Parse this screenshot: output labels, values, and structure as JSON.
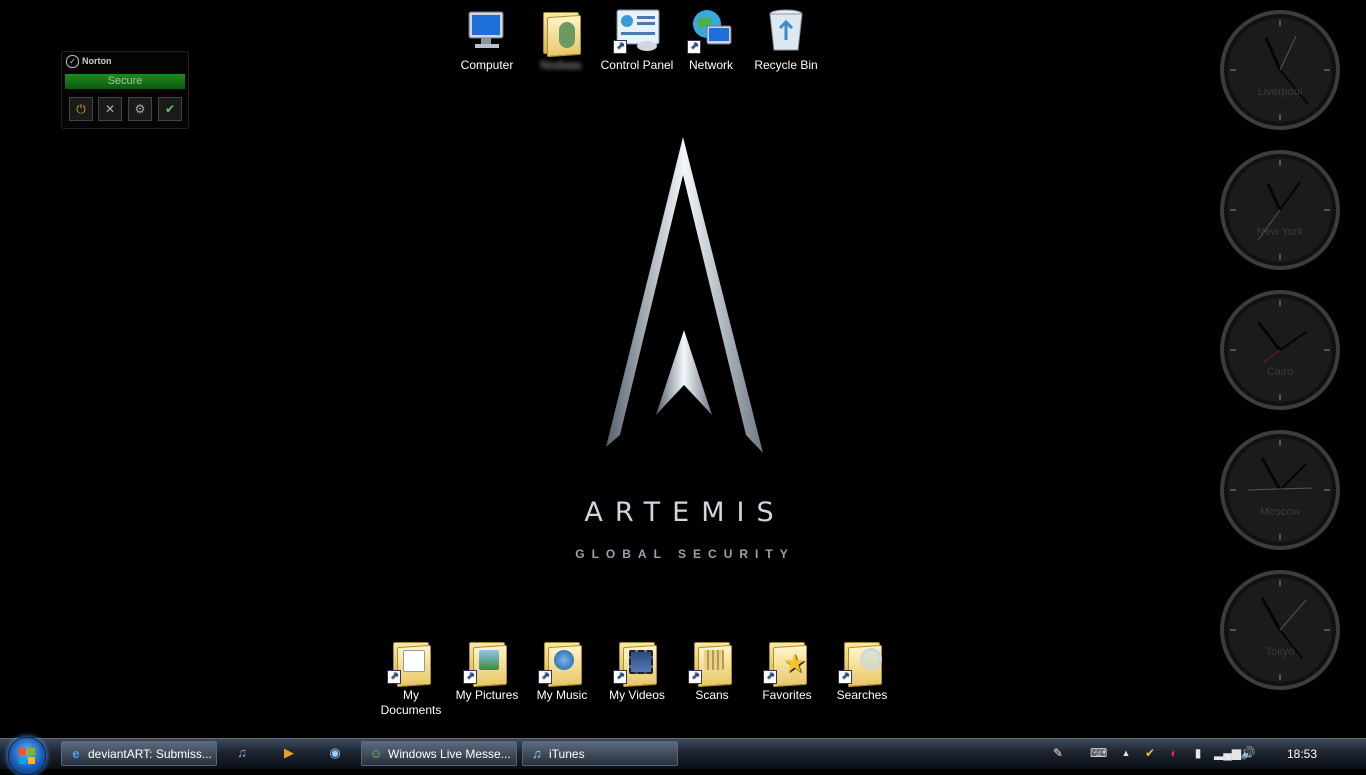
{
  "desktop_icons_top": [
    {
      "label": "Computer",
      "name": "desktop-icon-computer",
      "blur": false
    },
    {
      "label": "Nodaas",
      "name": "desktop-icon-user-folder",
      "blur": true
    },
    {
      "label": "Control Panel",
      "name": "desktop-icon-control-panel",
      "blur": false
    },
    {
      "label": "Network",
      "name": "desktop-icon-network",
      "blur": false
    },
    {
      "label": "Recycle Bin",
      "name": "desktop-icon-recycle-bin",
      "blur": false
    }
  ],
  "desktop_icons_bottom": [
    {
      "label": "My Documents",
      "name": "desktop-icon-my-documents"
    },
    {
      "label": "My Pictures",
      "name": "desktop-icon-my-pictures"
    },
    {
      "label": "My Music",
      "name": "desktop-icon-my-music"
    },
    {
      "label": "My Videos",
      "name": "desktop-icon-my-videos"
    },
    {
      "label": "Scans",
      "name": "desktop-icon-scans"
    },
    {
      "label": "Favorites",
      "name": "desktop-icon-favorites"
    },
    {
      "label": "Searches",
      "name": "desktop-icon-searches"
    }
  ],
  "norton": {
    "brand": "Norton",
    "status": "Secure"
  },
  "wallpaper": {
    "wordmark": "ARTEMIS",
    "tagline": "GLOBAL SECURITY"
  },
  "clocks": [
    {
      "city": "Liverpool"
    },
    {
      "city": "New York"
    },
    {
      "city": "Cairo"
    },
    {
      "city": "Moscow"
    },
    {
      "city": "Tokyo"
    }
  ],
  "taskbar": {
    "buttons": [
      {
        "label": "deviantART: Submiss...",
        "icon": "ie-icon"
      },
      {
        "label": "Windows Live Messe...",
        "icon": "messenger-icon"
      },
      {
        "label": "iTunes",
        "icon": "itunes-icon"
      }
    ],
    "quick_launch": [
      "itunes-icon",
      "media-player-icon",
      "camera-icon"
    ],
    "tray_icons": [
      "pen-tablet-icon",
      "keyboard-icon",
      "show-hidden-icon",
      "norton-tray-icon",
      "antivirus-tray-icon",
      "battery-icon",
      "signal-icon",
      "volume-icon"
    ],
    "time": "18:53"
  },
  "colors": {
    "taskbar": "#1c2430",
    "norton_green": "#1e8a1e",
    "background": "#000000"
  }
}
